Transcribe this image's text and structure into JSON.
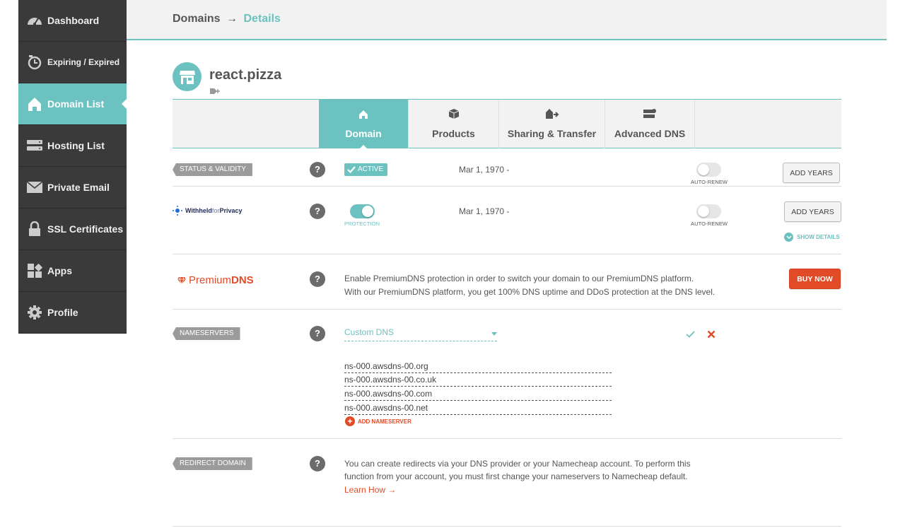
{
  "sidebar": {
    "items": [
      {
        "label": "Dashboard",
        "icon": "speedometer-icon"
      },
      {
        "label": "Expiring / Expired",
        "icon": "clock-icon"
      },
      {
        "label": "Domain List",
        "icon": "home-icon",
        "active": true
      },
      {
        "label": "Hosting List",
        "icon": "server-icon"
      },
      {
        "label": "Private Email",
        "icon": "envelope-icon"
      },
      {
        "label": "SSL Certificates",
        "icon": "lock-icon"
      },
      {
        "label": "Apps",
        "icon": "apps-icon"
      },
      {
        "label": "Profile",
        "icon": "gear-icon"
      }
    ]
  },
  "header": {
    "breadcrumb_root": "Domains",
    "breadcrumb_arrow": "→",
    "breadcrumb_current": "Details"
  },
  "domain": {
    "name": "react.pizza"
  },
  "tabs": [
    {
      "label": "Domain",
      "icon": "home-icon",
      "active": true
    },
    {
      "label": "Products",
      "icon": "box-icon"
    },
    {
      "label": "Sharing & Transfer",
      "icon": "share-icon"
    },
    {
      "label": "Advanced DNS",
      "icon": "dns-server-icon"
    }
  ],
  "status": {
    "label": "STATUS & VALIDITY",
    "help": "?",
    "badge": "ACTIVE",
    "date": "Mar 1, 1970 -",
    "autorenew_label": "AUTO-RENEW",
    "add_years": "ADD YEARS"
  },
  "privacy": {
    "brand_bold": "Withheld",
    "brand_light": "for",
    "brand_end": "Privacy",
    "help": "?",
    "protection_label": "PROTECTION",
    "date": "Mar 1, 1970 -",
    "autorenew_label": "AUTO-RENEW",
    "add_years": "ADD YEARS",
    "show_details": "SHOW DETAILS"
  },
  "premium_dns": {
    "brand_light": "Premium",
    "brand_bold": "DNS",
    "help": "?",
    "line1": "Enable PremiumDNS protection in order to switch your domain to our PremiumDNS platform.",
    "line2": "With our PremiumDNS platform, you get 100% DNS uptime and DDoS protection at the DNS level.",
    "buy_now": "BUY NOW"
  },
  "nameservers": {
    "label": "NAMESERVERS",
    "help": "?",
    "selected": "Custom DNS",
    "entries": [
      "ns-000.awsdns-00.org",
      "ns-000.awsdns-00.co.uk",
      "ns-000.awsdns-00.com",
      "ns-000.awsdns-00.net"
    ],
    "add_label": "ADD NAMESERVER"
  },
  "redirect": {
    "label": "REDIRECT DOMAIN",
    "help": "?",
    "line1": "You can create redirects via your DNS provider or your Namecheap account. To perform this",
    "line2": "function from your account, you must first change your nameservers to Namecheap default.",
    "learn_how": "Learn How →"
  },
  "colors": {
    "accent": "#6cc2c0",
    "danger": "#e14b27",
    "sidebar": "#3a3a3a"
  }
}
